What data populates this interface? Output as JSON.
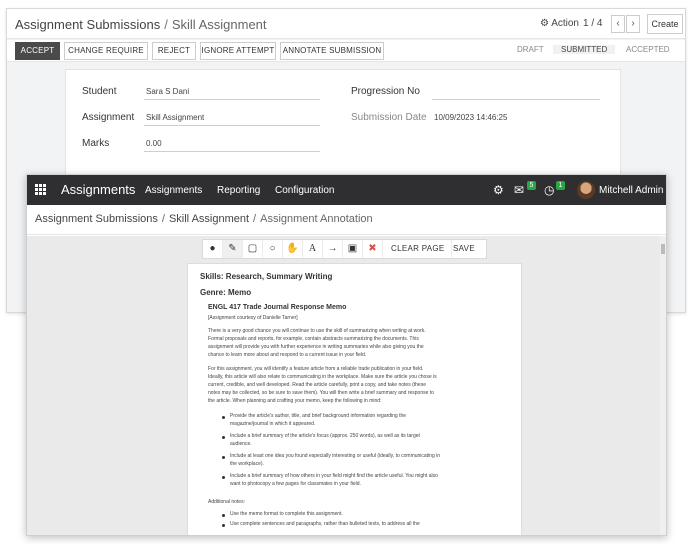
{
  "back": {
    "breadcrumb": {
      "parent": "Assignment Submissions",
      "sep": "/",
      "current": "Skill Assignment"
    },
    "action_label": "Action",
    "pager": "1 / 4",
    "create_label": "Create",
    "buttons": [
      "ACCEPT",
      "CHANGE REQUIRE",
      "REJECT",
      "IGNORE ATTEMPT",
      "ANNOTATE SUBMISSION"
    ],
    "stages": [
      "DRAFT",
      "SUBMITTED",
      "ACCEPTED"
    ],
    "fields": {
      "student_label": "Student",
      "student_value": "Sara S Dani",
      "assignment_label": "Assignment",
      "assignment_value": "Skill Assignment",
      "marks_label": "Marks",
      "marks_value": "0.00",
      "progression_label": "Progression No",
      "progression_value": "",
      "subdate_label": "Submission Date",
      "subdate_value": "10/09/2023 14:46:25"
    }
  },
  "front": {
    "brand": "Assignments",
    "menu": [
      "Assignments",
      "Reporting",
      "Configuration"
    ],
    "badges": {
      "chat": "5",
      "activity": "1"
    },
    "user": "Mitchell Admin",
    "breadcrumb": [
      "Assignment Submissions",
      "Skill Assignment",
      "Assignment Annotation"
    ],
    "toolbar": {
      "clear": "CLEAR PAGE",
      "save": "SAVE"
    },
    "document": {
      "skills": "Skills: Research, Summary Writing",
      "genre": "Genre: Memo",
      "title": "ENGL 417 Trade Journal Response Memo",
      "courtesy": "[Assignment courtesy of Danielle Tarner]",
      "para1": [
        "There is a very good chance you will continue to use the skill of summarizing when writing at work.",
        "Formal proposals and reports, for example, contain abstracts summarizing the documents.  This",
        "assignment will provide you with further experience in writing summaries while also giving you the",
        "chance to learn more about and respond to a current issue in your field."
      ],
      "para2": [
        "For this assignment, you will identify a feature article from a reliable trade publication in your field.",
        "Ideally, this article will also relate to communicating in the workplace. Make sure the article you chose is",
        "current, credible, and well developed. Read the article carefully, print a copy, and take notes (these",
        "notes may be collected, so be sure to save them).  You will then write a brief summary and response to",
        "the article. When planning and crafting your memo, keep the following in mind:"
      ],
      "bullets": [
        [
          "Provide the article's author, title, and brief background information regarding the",
          "magazine/journal in which it appeared."
        ],
        [
          "Include a brief summary of the article's focus (approx. 250 words), as well as its target",
          "audience."
        ],
        [
          "Include at least one idea you found especially interesting or useful (ideally, to communicating in",
          "the workplace)."
        ],
        [
          "Include a brief summary of how others in your field might find the article useful. You might also",
          "want to photocopy a few pages for classmates in your field."
        ]
      ],
      "notes_label": "Additional notes:",
      "notes": [
        "Use the memo format to complete this assignment.",
        "Use complete sentences and paragraphs, rather than bulleted texts, to address all the"
      ]
    }
  }
}
